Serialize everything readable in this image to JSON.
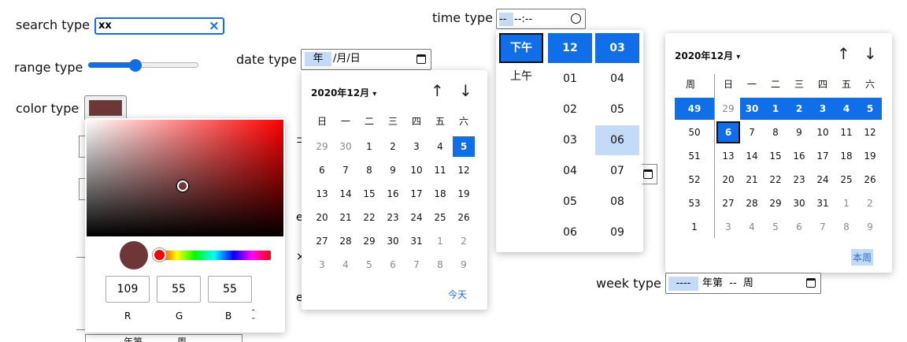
{
  "search": {
    "label": "search type",
    "value": "xx",
    "clear": "×"
  },
  "range": {
    "label": "range type",
    "fraction": 0.46
  },
  "color": {
    "label": "color type",
    "swatch": "#6d3737",
    "hue": "#ff0000",
    "r": "109",
    "g": "55",
    "b": "55",
    "r_label": "R",
    "g_label": "G",
    "b_label": "B",
    "mode_toggle": "⌃⌄"
  },
  "date": {
    "label": "date type",
    "placeholder_year": "年",
    "placeholder_rest": "/月/日",
    "header": "2020年12月",
    "weekdays": [
      "日",
      "一",
      "二",
      "三",
      "四",
      "五",
      "六"
    ],
    "rows": [
      [
        "29",
        "30",
        "1",
        "2",
        "3",
        "4",
        "5"
      ],
      [
        "6",
        "7",
        "8",
        "9",
        "10",
        "11",
        "12"
      ],
      [
        "13",
        "14",
        "15",
        "16",
        "17",
        "18",
        "19"
      ],
      [
        "20",
        "21",
        "22",
        "23",
        "24",
        "25",
        "26"
      ],
      [
        "27",
        "28",
        "29",
        "30",
        "31",
        "1",
        "2"
      ],
      [
        "3",
        "4",
        "5",
        "6",
        "7",
        "8",
        "9"
      ]
    ],
    "today": "今天"
  },
  "time": {
    "label": "time type",
    "placeholder": "--:--",
    "ampm": [
      "下午",
      "上午"
    ],
    "hours": [
      "12",
      "01",
      "02",
      "03",
      "04",
      "05",
      "06"
    ],
    "minutes": [
      "03",
      "04",
      "05",
      "06",
      "07",
      "08",
      "09"
    ]
  },
  "week": {
    "label": "week type",
    "placeholder": "---- 年第 -- 周",
    "header": "2020年12月",
    "week_col": "周",
    "weekdays": [
      "日",
      "一",
      "二",
      "三",
      "四",
      "五",
      "六"
    ],
    "rows": [
      {
        "week": "49",
        "days": [
          "29",
          "30",
          "1",
          "2",
          "3",
          "4",
          "5"
        ]
      },
      {
        "week": "50",
        "days": [
          "6",
          "7",
          "8",
          "9",
          "10",
          "11",
          "12"
        ]
      },
      {
        "week": "51",
        "days": [
          "13",
          "14",
          "15",
          "16",
          "17",
          "18",
          "19"
        ]
      },
      {
        "week": "52",
        "days": [
          "20",
          "21",
          "22",
          "23",
          "24",
          "25",
          "26"
        ]
      },
      {
        "week": "53",
        "days": [
          "27",
          "28",
          "29",
          "30",
          "31",
          "1",
          "2"
        ]
      },
      {
        "week": "1",
        "days": [
          "3",
          "4",
          "5",
          "6",
          "7",
          "8",
          "9"
        ]
      }
    ],
    "this_week": "本周"
  },
  "background": {
    "row1": "年第",
    "row1b": "周"
  },
  "icons": {
    "up": "↑",
    "down": "↓",
    "caret": "▾"
  }
}
